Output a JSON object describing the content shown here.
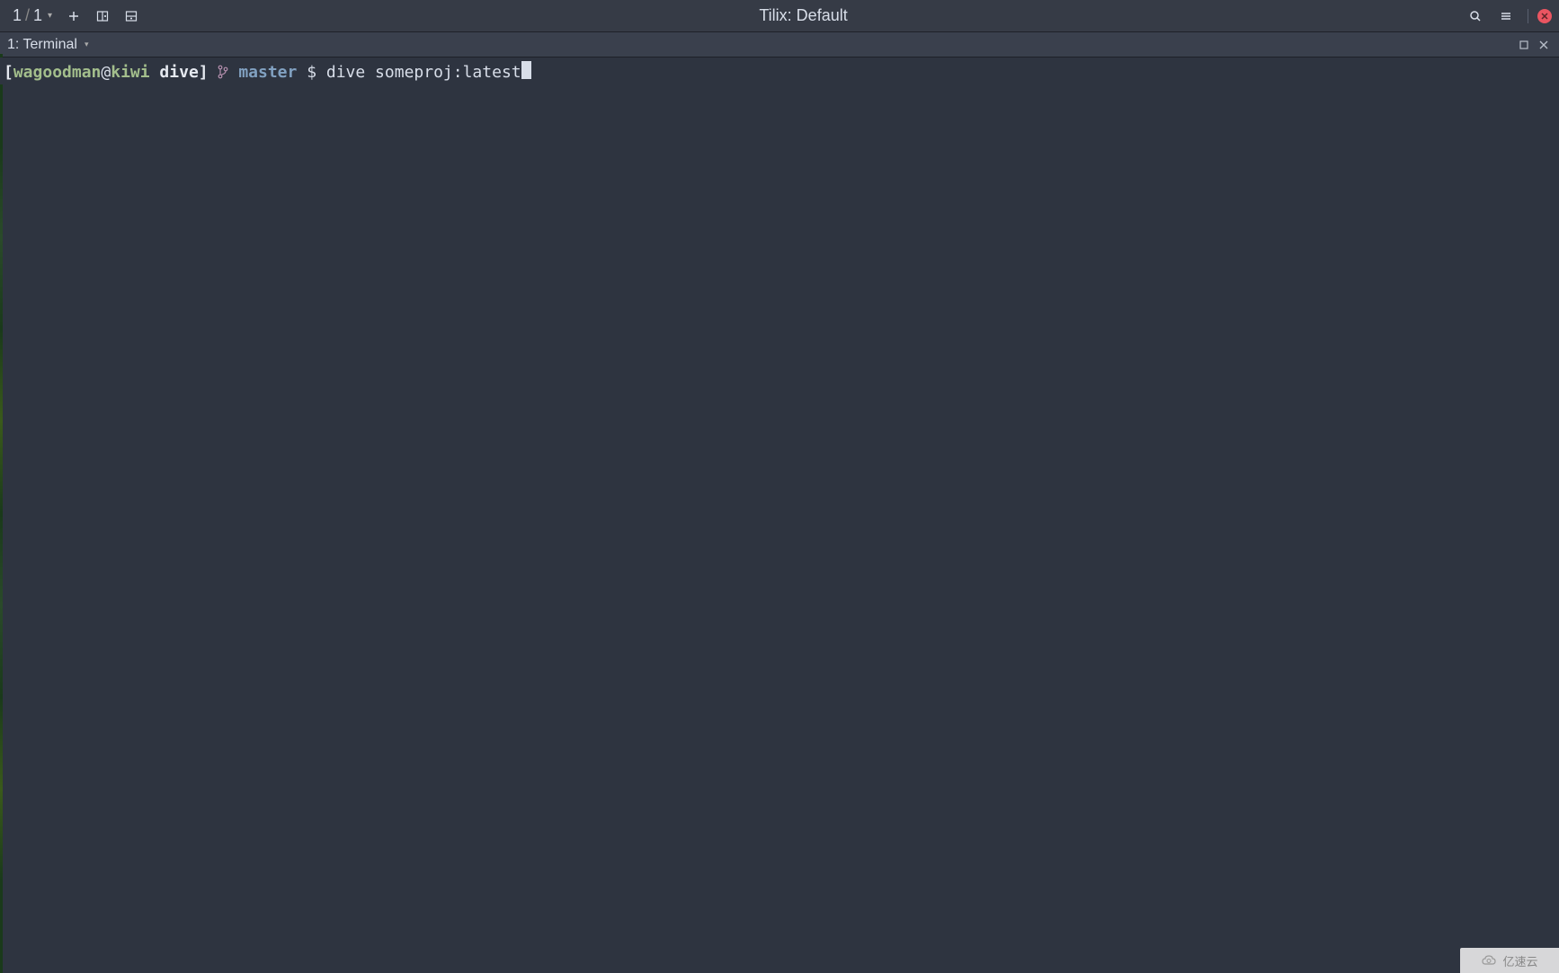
{
  "titlebar": {
    "session_current": "1",
    "session_total": "1",
    "title": "Tilix: Default"
  },
  "tab": {
    "label": "1: Terminal"
  },
  "prompt": {
    "bracket_open": "[",
    "user": "wagoodman",
    "at": "@",
    "host": "kiwi",
    "dir": " dive",
    "bracket_close": "]",
    "branch": "master",
    "dollar": "$",
    "command": "dive someproj:latest"
  },
  "watermark": {
    "text": "亿速云"
  }
}
